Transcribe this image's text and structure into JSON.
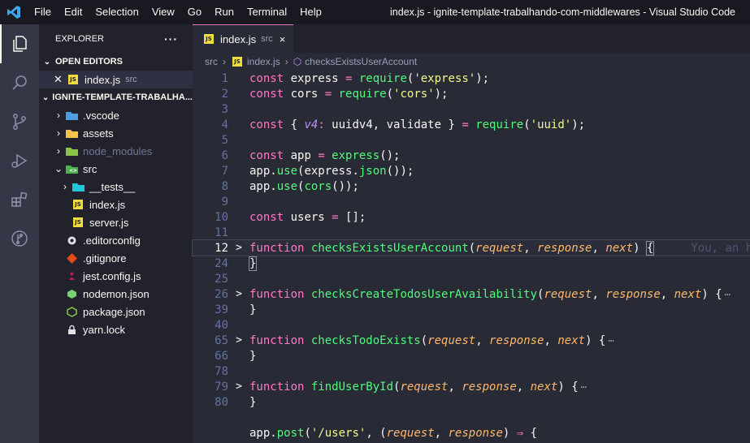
{
  "titlebar": {
    "menu": [
      "File",
      "Edit",
      "Selection",
      "View",
      "Go",
      "Run",
      "Terminal",
      "Help"
    ],
    "title": "index.js - ignite-template-trabalhando-com-middlewares - Visual Studio Code"
  },
  "colors": {
    "accent": "#ff79c6",
    "background": "#282a36",
    "sidebar": "#21222c",
    "activity": "#343746"
  },
  "activity_bar": [
    {
      "icon": "files-icon",
      "active": true
    },
    {
      "icon": "search-icon"
    },
    {
      "icon": "source-control-icon"
    },
    {
      "icon": "run-debug-icon"
    },
    {
      "icon": "extensions-icon"
    },
    {
      "icon": "git-graph-icon"
    }
  ],
  "explorer": {
    "title": "EXPLORER",
    "more": "···",
    "open_editors": {
      "label": "OPEN EDITORS",
      "items": [
        {
          "name": "index.js",
          "folder": "src"
        }
      ]
    },
    "project": {
      "label": "IGNITE-TEMPLATE-TRABALHA...",
      "items": [
        {
          "name": ".vscode",
          "type": "folder"
        },
        {
          "name": "assets",
          "type": "folder"
        },
        {
          "name": "node_modules",
          "type": "folder"
        },
        {
          "name": "src",
          "type": "folder-open"
        },
        {
          "name": "__tests__",
          "type": "folder"
        },
        {
          "name": "index.js",
          "type": "js"
        },
        {
          "name": "server.js",
          "type": "js"
        },
        {
          "name": ".editorconfig",
          "type": "file"
        },
        {
          "name": ".gitignore",
          "type": "file"
        },
        {
          "name": "jest.config.js",
          "type": "file"
        },
        {
          "name": "nodemon.json",
          "type": "file"
        },
        {
          "name": "package.json",
          "type": "file"
        },
        {
          "name": "yarn.lock",
          "type": "file"
        }
      ]
    }
  },
  "editor": {
    "tab": {
      "name": "index.js",
      "folder": "src",
      "close": "×"
    },
    "breadcrumb": [
      "src",
      "index.js",
      "checksExistsUserAccount"
    ],
    "line_numbers": [
      "1",
      "2",
      "3",
      "4",
      "5",
      "6",
      "7",
      "8",
      "9",
      "10",
      "11",
      "12",
      "24",
      "25",
      "26",
      "39",
      "40",
      "65",
      "66",
      "78",
      "79",
      "80"
    ],
    "fold_markers": {
      "12": ">",
      "26": ">",
      "40": ">",
      "66": ">"
    },
    "codelens": "You, an h",
    "ellipsis": "⋯"
  }
}
